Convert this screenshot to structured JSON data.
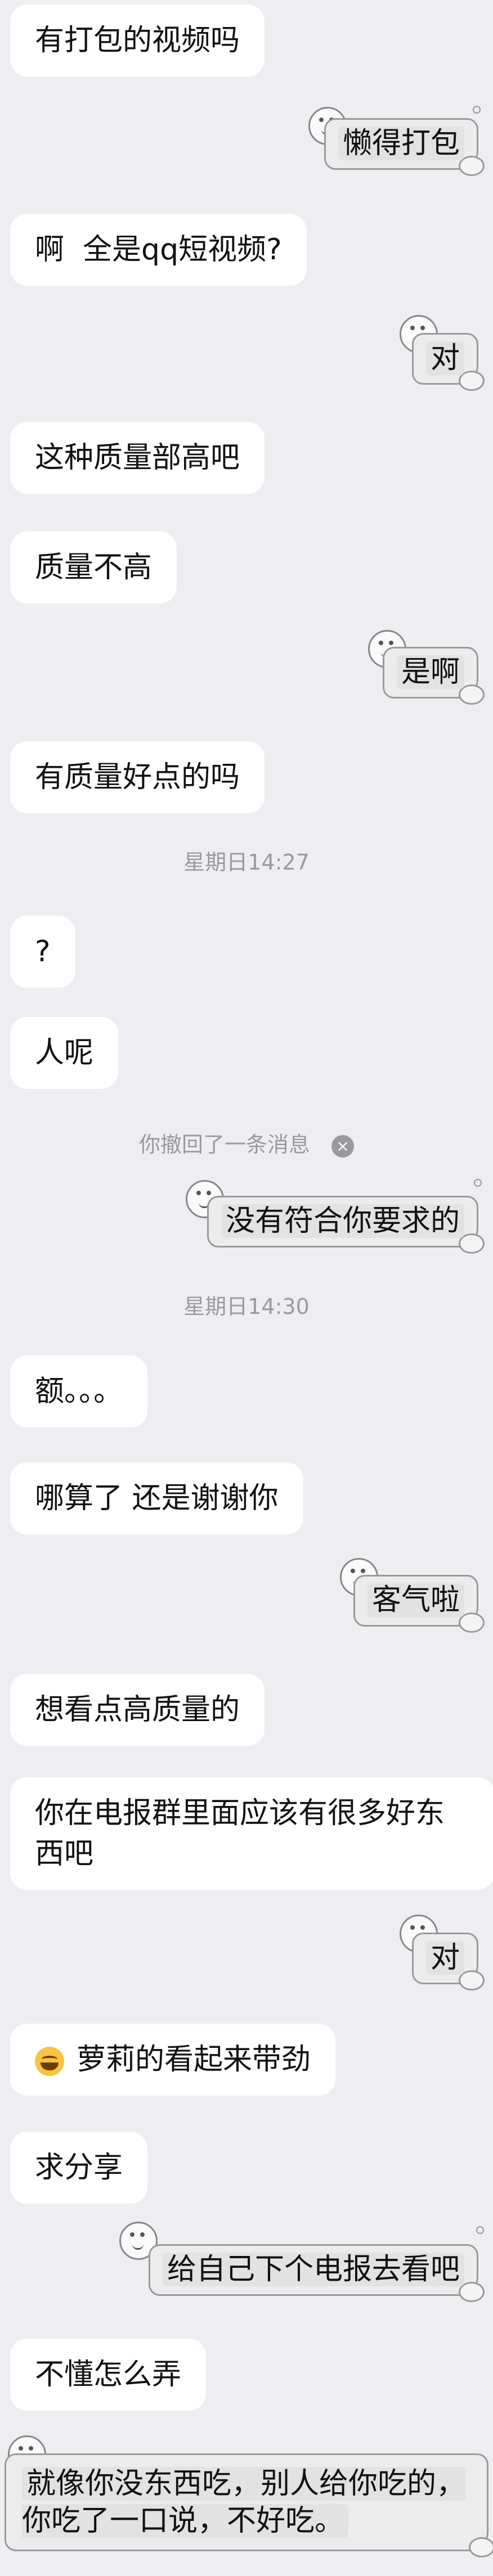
{
  "messages": [
    {
      "side": "in",
      "text": "有打包的视频吗"
    },
    {
      "side": "out",
      "text": "懒得打包"
    },
    {
      "side": "in",
      "text": "啊  全是qq短视频?"
    },
    {
      "side": "out",
      "text": "对"
    },
    {
      "side": "in",
      "text": "这种质量部高吧"
    },
    {
      "side": "in",
      "text": "质量不高"
    },
    {
      "side": "out",
      "text": "是啊"
    },
    {
      "side": "in",
      "text": "有质量好点的吗"
    },
    {
      "side": "in",
      "text": "?"
    },
    {
      "side": "in",
      "text": "人呢"
    },
    {
      "side": "out",
      "text": "没有符合你要求的"
    },
    {
      "side": "in",
      "text": "额。。。"
    },
    {
      "side": "in",
      "text": "哪算了 还是谢谢你"
    },
    {
      "side": "out",
      "text": "客气啦"
    },
    {
      "side": "in",
      "text": "想看点高质量的"
    },
    {
      "side": "in",
      "text": "你在电报群里面应该有很多好东\n西吧"
    },
    {
      "side": "out",
      "text": "对"
    },
    {
      "side": "in",
      "text": "萝莉的看起来带劲"
    },
    {
      "side": "in",
      "text": "求分享"
    },
    {
      "side": "out",
      "text": "给自己下个电报去看吧"
    },
    {
      "side": "in",
      "text": "不懂怎么弄"
    },
    {
      "side": "out",
      "text": "就像你没东西吃，别人给你吃的，\n你吃了一口说，不好吃。"
    }
  ],
  "timestamps": [
    "星期日14:27",
    "星期日14:30"
  ],
  "recall_notice": "你撤回了一条消息",
  "recall_close_icon": "×",
  "emoji_icon": "grinning-sweat-emoji"
}
